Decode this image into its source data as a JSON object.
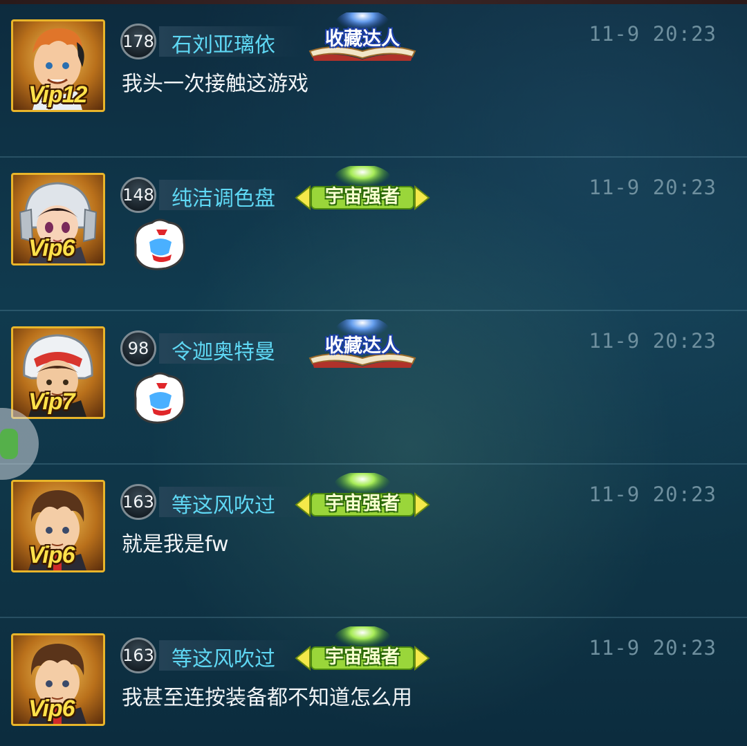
{
  "posts": [
    {
      "level": "178",
      "name": "石刘亚璃依",
      "badge": "收藏达人",
      "badge_type": "collect",
      "time": "11-9  20:23",
      "vip": "Vip12",
      "message": "我头一次接触这游戏",
      "emoji": null,
      "avatar_icon": "orange-hair-boy-avatar"
    },
    {
      "level": "148",
      "name": "纯洁调色盘",
      "badge": "宇宙强者",
      "badge_type": "cosmic",
      "time": "11-9  20:23",
      "vip": "Vip6",
      "message": "",
      "emoji": "hand-emoji",
      "avatar_icon": "helmet-girl-avatar"
    },
    {
      "level": "98",
      "name": "令迦奥特曼",
      "badge": "收藏达人",
      "badge_type": "collect",
      "time": "11-9  20:23",
      "vip": "Vip7",
      "message": "",
      "emoji": "hand-emoji",
      "avatar_icon": "helmet-boy-avatar"
    },
    {
      "level": "163",
      "name": "等这风吹过",
      "badge": "宇宙强者",
      "badge_type": "cosmic",
      "time": "11-9  20:23",
      "vip": "Vip6",
      "message": "就是我是fw",
      "emoji": null,
      "avatar_icon": "brown-hair-boy-avatar"
    },
    {
      "level": "163",
      "name": "等这风吹过",
      "badge": "宇宙强者",
      "badge_type": "cosmic",
      "time": "11-9  20:23",
      "vip": "Vip6",
      "message": "我甚至连按装备都不知道怎么用",
      "emoji": null,
      "avatar_icon": "brown-hair-boy-avatar"
    }
  ],
  "colors": {
    "name": "#5fd8f4",
    "message": "#f1f4f6",
    "time": "#6e8f9e",
    "vip": "#ffe14a",
    "avatar_border": "#e9b52a"
  }
}
